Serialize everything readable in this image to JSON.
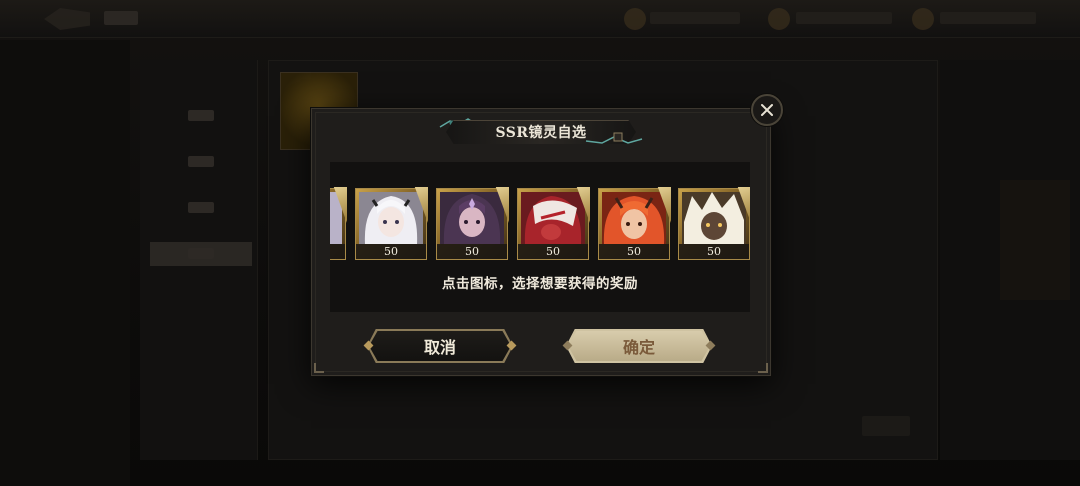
{
  "dialog": {
    "title": "SSR镜灵自选",
    "hint": "点击图标，选择想要获得的奖励",
    "cancel_label": "取消",
    "confirm_label": "确定"
  },
  "rewards": [
    {
      "name": "partial-left",
      "level": ""
    },
    {
      "name": "white-haired-spirit",
      "level": "50"
    },
    {
      "name": "purple-haired-spirit",
      "level": "50"
    },
    {
      "name": "masked-red-spirit",
      "level": "50"
    },
    {
      "name": "red-horned-spirit",
      "level": "50"
    },
    {
      "name": "blonde-dark-spirit",
      "level": "50"
    }
  ],
  "icons": {
    "close": "close-icon",
    "back": "back-arrow-icon"
  },
  "colors": {
    "card_gold": "#c9a24a",
    "confirm_text": "#7a5a3a",
    "panel_bg": "#1f1d1b"
  }
}
